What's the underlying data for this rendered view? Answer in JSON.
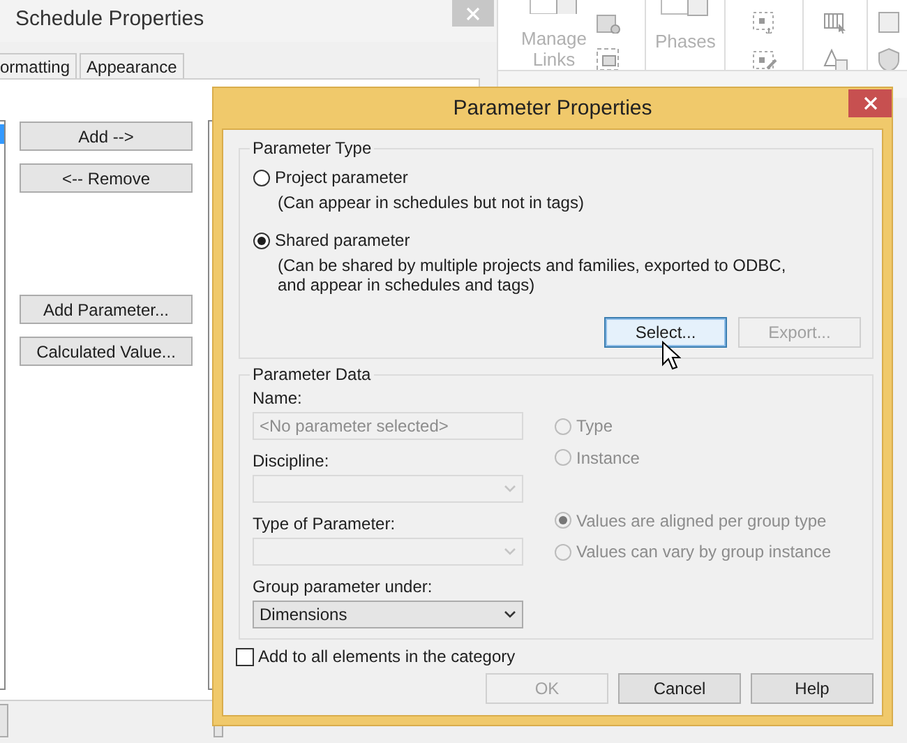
{
  "schedule_window": {
    "title": "Schedule Properties",
    "tabs": [
      {
        "label": "ormatting",
        "selected": false
      },
      {
        "label": "Appearance",
        "selected": false
      }
    ],
    "buttons": [
      "Add -->",
      "<-- Remove",
      "Add Parameter...",
      "Calculated Value..."
    ]
  },
  "ribbon": {
    "buttons": [
      "Manage Links",
      "Phases"
    ]
  },
  "dialog": {
    "title": "Parameter Properties",
    "parameter_type": {
      "legend": "Parameter Type",
      "options": [
        {
          "label": "Project parameter",
          "description": "(Can appear in schedules but not in tags)",
          "selected": false
        },
        {
          "label": "Shared parameter",
          "description": "(Can be shared by multiple projects and families, exported to ODBC, and appear in schedules and tags)",
          "selected": true
        }
      ],
      "buttons": [
        {
          "label": "Select...",
          "disabled": false,
          "focused": true
        },
        {
          "label": "Export...",
          "disabled": true,
          "focused": false
        }
      ]
    },
    "parameter_data": {
      "legend": "Parameter Data",
      "fields": [
        {
          "kind": "text",
          "label": "Name:",
          "value": "<No parameter selected>",
          "disabled": true
        },
        {
          "kind": "select",
          "label": "Discipline:",
          "disabled": true
        },
        {
          "kind": "select",
          "label": "Type of Parameter:",
          "disabled": true
        },
        {
          "kind": "select",
          "label": "Group parameter under:",
          "value": "Dimensions",
          "disabled": false
        }
      ],
      "type_options": [
        {
          "label": "Type",
          "selected": false,
          "disabled": true
        },
        {
          "label": "Instance",
          "selected": false,
          "disabled": true
        }
      ],
      "group_options": [
        {
          "label": "Values are aligned per group type",
          "selected": true,
          "disabled": true
        },
        {
          "label": "Values can vary by group instance",
          "selected": false,
          "disabled": true
        }
      ]
    },
    "add_to_all": {
      "label": "Add to all elements in the category",
      "checked": false
    },
    "buttons": [
      {
        "label": "OK",
        "disabled": true
      },
      {
        "label": "Cancel",
        "disabled": false
      },
      {
        "label": "Help",
        "disabled": false
      }
    ]
  }
}
